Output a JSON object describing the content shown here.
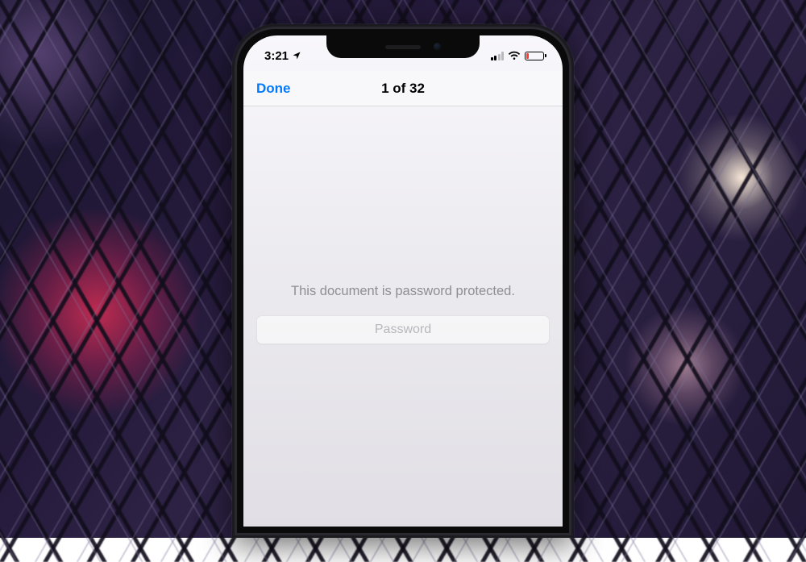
{
  "statusbar": {
    "time": "3:21",
    "location_icon": "location-arrow",
    "signal_bars_active": 2,
    "signal_bars_total": 4,
    "wifi_icon": "wifi",
    "battery_low_color": "#ff3b30",
    "battery_icon": "battery-low"
  },
  "navbar": {
    "done_label": "Done",
    "title": "1 of 32"
  },
  "content": {
    "message": "This document is password protected.",
    "password_placeholder": "Password"
  },
  "colors": {
    "ios_link": "#007aff",
    "secondary_text": "#8e8e93"
  }
}
